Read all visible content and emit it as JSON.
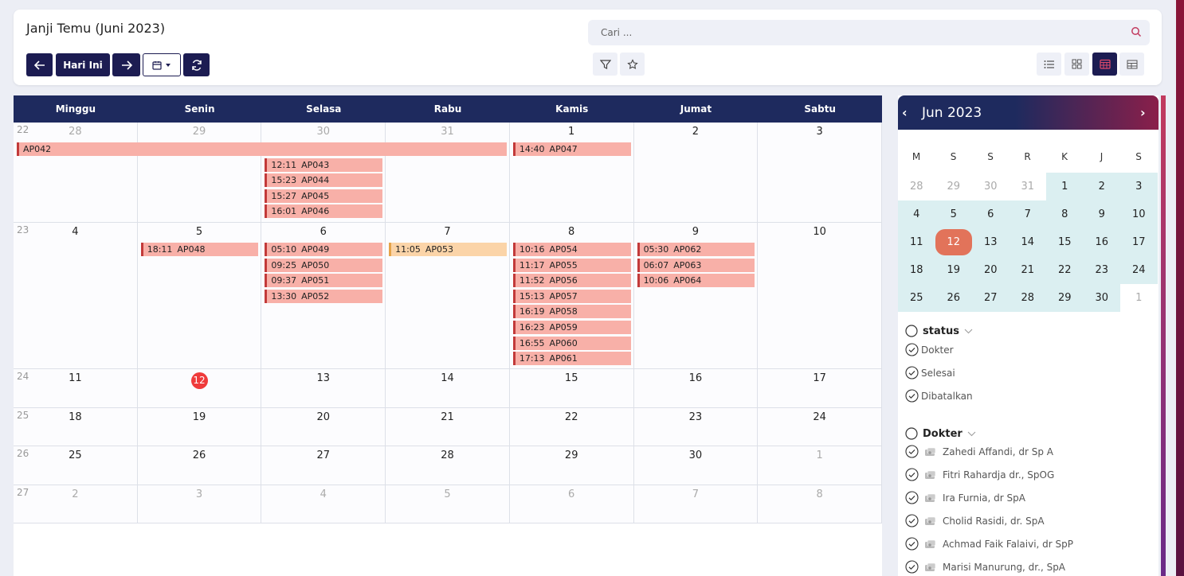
{
  "header": {
    "title": "Janji Temu (Juni 2023)",
    "today_label": "Hari Ini"
  },
  "search": {
    "placeholder": "Cari ..."
  },
  "calendar": {
    "day_headers": [
      "Minggu",
      "Senin",
      "Selasa",
      "Rabu",
      "Kamis",
      "Jumat",
      "Sabtu"
    ],
    "weeks": [
      {
        "num": "22",
        "days": [
          "28",
          "29",
          "30",
          "31",
          "1",
          "2",
          "3"
        ],
        "muted": [
          true,
          true,
          true,
          true,
          false,
          false,
          false
        ]
      },
      {
        "num": "23",
        "days": [
          "4",
          "5",
          "6",
          "7",
          "8",
          "9",
          "10"
        ],
        "muted": [
          false,
          false,
          false,
          false,
          false,
          false,
          false
        ]
      },
      {
        "num": "24",
        "days": [
          "11",
          "12",
          "13",
          "14",
          "15",
          "16",
          "17"
        ],
        "muted": [
          false,
          false,
          false,
          false,
          false,
          false,
          false
        ],
        "today_index": 1
      },
      {
        "num": "25",
        "days": [
          "18",
          "19",
          "20",
          "21",
          "22",
          "23",
          "24"
        ],
        "muted": [
          false,
          false,
          false,
          false,
          false,
          false,
          false
        ]
      },
      {
        "num": "26",
        "days": [
          "25",
          "26",
          "27",
          "28",
          "29",
          "30",
          "1"
        ],
        "muted": [
          false,
          false,
          false,
          false,
          false,
          false,
          true
        ]
      },
      {
        "num": "27",
        "days": [
          "2",
          "3",
          "4",
          "5",
          "6",
          "7",
          "8"
        ],
        "muted": [
          true,
          true,
          true,
          true,
          true,
          true,
          true
        ]
      }
    ],
    "events": [
      {
        "week": 0,
        "day": 0,
        "span": 4,
        "slot": 0,
        "time": "",
        "code": "AP042"
      },
      {
        "week": 0,
        "day": 4,
        "span": 1,
        "slot": 0,
        "time": "14:40",
        "code": "AP047"
      },
      {
        "week": 0,
        "day": 2,
        "span": 1,
        "slot": 1,
        "time": "12:11",
        "code": "AP043"
      },
      {
        "week": 0,
        "day": 2,
        "span": 1,
        "slot": 2,
        "time": "15:23",
        "code": "AP044"
      },
      {
        "week": 0,
        "day": 2,
        "span": 1,
        "slot": 3,
        "time": "15:27",
        "code": "AP045"
      },
      {
        "week": 0,
        "day": 2,
        "span": 1,
        "slot": 4,
        "time": "16:01",
        "code": "AP046"
      },
      {
        "week": 1,
        "day": 1,
        "span": 1,
        "slot": 0,
        "time": "18:11",
        "code": "AP048"
      },
      {
        "week": 1,
        "day": 2,
        "span": 1,
        "slot": 0,
        "time": "05:10",
        "code": "AP049"
      },
      {
        "week": 1,
        "day": 2,
        "span": 1,
        "slot": 1,
        "time": "09:25",
        "code": "AP050"
      },
      {
        "week": 1,
        "day": 2,
        "span": 1,
        "slot": 2,
        "time": "09:37",
        "code": "AP051"
      },
      {
        "week": 1,
        "day": 2,
        "span": 1,
        "slot": 3,
        "time": "13:30",
        "code": "AP052"
      },
      {
        "week": 1,
        "day": 3,
        "span": 1,
        "slot": 0,
        "time": "11:05",
        "code": "AP053",
        "tone": "amber"
      },
      {
        "week": 1,
        "day": 4,
        "span": 1,
        "slot": 0,
        "time": "10:16",
        "code": "AP054"
      },
      {
        "week": 1,
        "day": 4,
        "span": 1,
        "slot": 1,
        "time": "11:17",
        "code": "AP055"
      },
      {
        "week": 1,
        "day": 4,
        "span": 1,
        "slot": 2,
        "time": "11:52",
        "code": "AP056"
      },
      {
        "week": 1,
        "day": 4,
        "span": 1,
        "slot": 3,
        "time": "15:13",
        "code": "AP057"
      },
      {
        "week": 1,
        "day": 4,
        "span": 1,
        "slot": 4,
        "time": "16:19",
        "code": "AP058"
      },
      {
        "week": 1,
        "day": 4,
        "span": 1,
        "slot": 5,
        "time": "16:23",
        "code": "AP059"
      },
      {
        "week": 1,
        "day": 4,
        "span": 1,
        "slot": 6,
        "time": "16:55",
        "code": "AP060"
      },
      {
        "week": 1,
        "day": 4,
        "span": 1,
        "slot": 7,
        "time": "17:13",
        "code": "AP061"
      },
      {
        "week": 1,
        "day": 5,
        "span": 1,
        "slot": 0,
        "time": "05:30",
        "code": "AP062"
      },
      {
        "week": 1,
        "day": 5,
        "span": 1,
        "slot": 1,
        "time": "06:07",
        "code": "AP063"
      },
      {
        "week": 1,
        "day": 5,
        "span": 1,
        "slot": 2,
        "time": "10:06",
        "code": "AP064"
      }
    ]
  },
  "mini": {
    "title": "Jun 2023",
    "dow": [
      "M",
      "S",
      "S",
      "R",
      "K",
      "J",
      "S"
    ],
    "rows": [
      [
        "28",
        "29",
        "30",
        "31",
        "1",
        "2",
        "3"
      ],
      [
        "4",
        "5",
        "6",
        "7",
        "8",
        "9",
        "10"
      ],
      [
        "11",
        "12",
        "13",
        "14",
        "15",
        "16",
        "17"
      ],
      [
        "18",
        "19",
        "20",
        "21",
        "22",
        "23",
        "24"
      ],
      [
        "25",
        "26",
        "27",
        "28",
        "29",
        "30",
        "1"
      ]
    ],
    "today": "12"
  },
  "filters": {
    "status": {
      "label": "status",
      "items": [
        "Dokter",
        "Selesai",
        "Dibatalkan"
      ]
    },
    "dokter": {
      "label": "Dokter",
      "items": [
        "Zahedi Affandi, dr Sp A",
        "Fitri Rahardja dr., SpOG",
        "Ira Furnia, dr SpA",
        "Cholid Rasidi, dr. SpA",
        "Achmad Faik Falaivi, dr SpP",
        "Marisi Manurung, dr., SpA"
      ]
    }
  }
}
